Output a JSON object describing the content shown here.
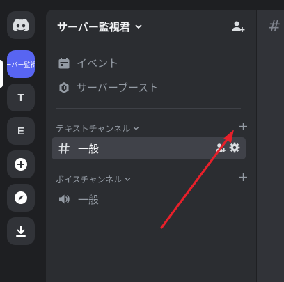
{
  "rail": {
    "active_server_label": "サーバー監視君",
    "server_t": "T",
    "server_e": "E"
  },
  "server": {
    "name": "サーバー監視君"
  },
  "menu": {
    "events_label": "イベント",
    "boost_label": "サーバーブースト"
  },
  "text_category": {
    "label": "テキストチャンネル",
    "channels": [
      {
        "name": "一般"
      }
    ]
  },
  "voice_category": {
    "label": "ボイスチャンネル",
    "channels": [
      {
        "name": "一般"
      }
    ]
  },
  "colors": {
    "accent": "#5865f2",
    "annotation_arrow": "#e8202a"
  }
}
